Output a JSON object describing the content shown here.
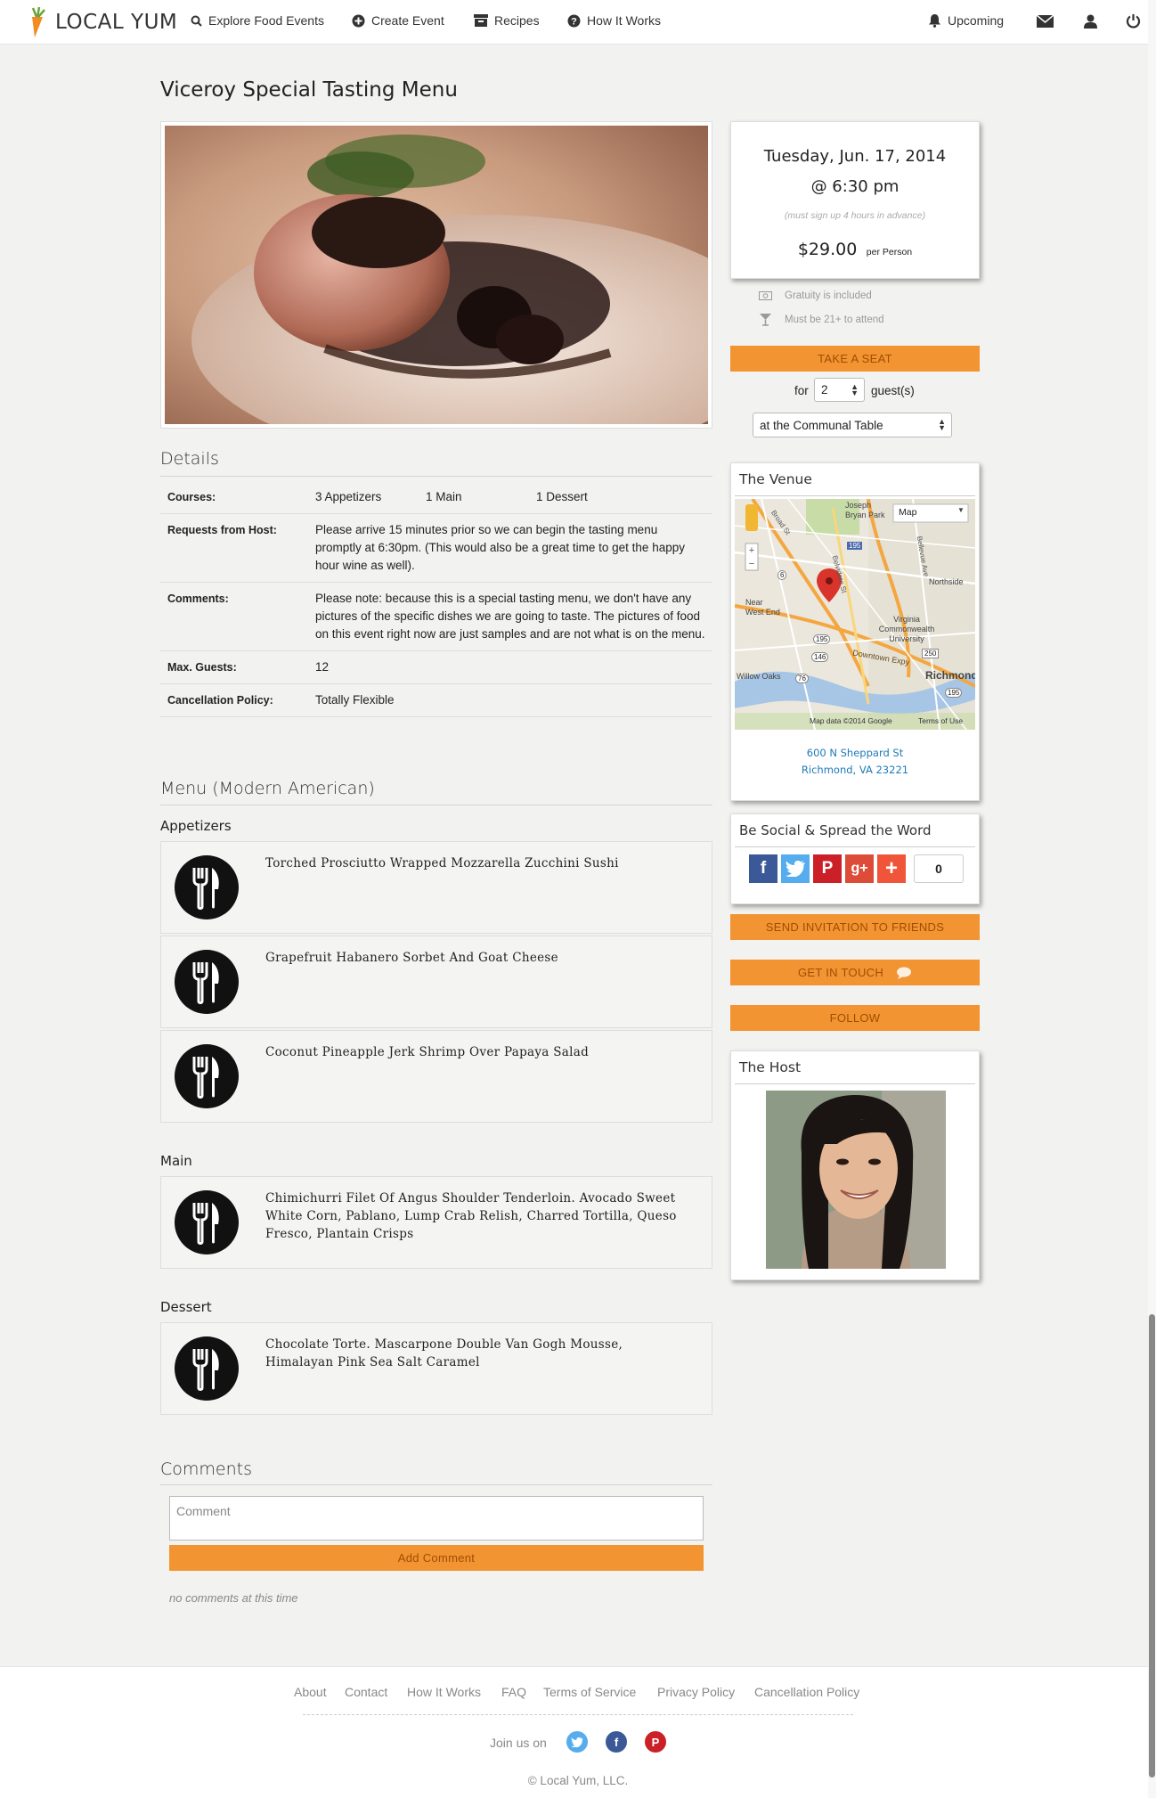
{
  "nav": {
    "logo_text": "LOCAL YUM",
    "explore": "Explore Food Events",
    "create": "Create Event",
    "recipes": "Recipes",
    "how": "How It Works",
    "upcoming": "Upcoming"
  },
  "event": {
    "title": "Viceroy Special Tasting Menu",
    "date": "Tuesday, Jun. 17, 2014",
    "time": "@ 6:30 pm",
    "signup_note": "(must sign up 4 hours in advance)",
    "price": "$29.00",
    "price_unit": "per Person",
    "gratuity": "Gratuity is included",
    "age": "Must be 21+ to attend",
    "take_seat": "TAKE A SEAT",
    "for_label": "for",
    "guests_value": "2",
    "guests_label": "guest(s)",
    "table_option": "at the Communal Table"
  },
  "details": {
    "heading": "Details",
    "courses_label": "Courses:",
    "courses": [
      "3 Appetizers",
      "1 Main",
      "1 Dessert"
    ],
    "requests_label": "Requests from Host:",
    "requests": "Please arrive 15 minutes prior so we can begin the tasting menu promptly at 6:30pm. (This would also be a great time to get the happy hour wine as well).",
    "comments_label": "Comments:",
    "comments": "Please note: because this is a special tasting menu, we don't have any pictures of the specific dishes we are going to taste. The pictures of food on this event right now are just samples and are not what is on the menu.",
    "max_label": "Max. Guests:",
    "max": "12",
    "cancel_label": "Cancellation Policy:",
    "cancel": "Totally Flexible"
  },
  "menu": {
    "heading": "Menu (Modern American)",
    "appetizers_label": "Appetizers",
    "appetizers": [
      "Torched Prosciutto Wrapped Mozzarella Zucchini Sushi",
      "Grapefruit Habanero Sorbet And Goat Cheese",
      "Coconut Pineapple Jerk Shrimp Over Papaya Salad"
    ],
    "main_label": "Main",
    "main": [
      "Chimichurri Filet Of Angus Shoulder Tenderloin. Avocado Sweet White Corn, Pablano, Lump Crab Relish, Charred Tortilla, Queso Fresco, Plantain Crisps"
    ],
    "dessert_label": "Dessert",
    "dessert": [
      "Chocolate Torte. Mascarpone Double Van Gogh Mousse, Himalayan Pink Sea Salt Caramel"
    ]
  },
  "comments": {
    "heading": "Comments",
    "placeholder": "Comment",
    "add_button": "Add Comment",
    "empty": "no comments at this time"
  },
  "venue": {
    "title": "The Venue",
    "map_type": "Map",
    "map_credit": "Map data ©2014 Google",
    "terms": "Terms of Use",
    "map_labels": [
      "Joseph Bryan Park",
      "Northside",
      "Near West End",
      "Virginia Commonwealth University",
      "Willow Oaks",
      "Richmond",
      "Downtown Expy",
      "Broad St",
      "Bellevue Ave",
      "Belvidere St"
    ],
    "routes": [
      "195",
      "6",
      "195",
      "146",
      "76",
      "250",
      "195"
    ],
    "address_line1": "600 N Sheppard St",
    "address_line2": "Richmond, VA 23221"
  },
  "social": {
    "title": "Be Social & Spread the Word",
    "count": "0"
  },
  "actions": {
    "invite": "SEND INVITATION TO FRIENDS",
    "contact": "GET IN TOUCH",
    "follow": "FOLLOW"
  },
  "host": {
    "title": "The Host"
  },
  "footer": {
    "links": [
      "About",
      "Contact",
      "How It Works",
      "FAQ",
      "Terms of Service",
      "Privacy Policy",
      "Cancellation Policy"
    ],
    "join": "Join us on",
    "copyright": "© Local Yum, LLC."
  },
  "colors": {
    "accent": "#f29431",
    "link": "#1f7ab8",
    "facebook": "#3b5998",
    "twitter": "#55acee",
    "pinterest": "#cb2027",
    "gplus": "#dd4b39"
  },
  "icons": [
    "carrot-logo-icon",
    "search-icon",
    "plus-circle-icon",
    "archive-icon",
    "question-icon",
    "bell-icon",
    "envelope-icon",
    "user-icon",
    "power-icon",
    "fork-knife-icon",
    "money-icon",
    "cocktail-icon",
    "map-pin-icon",
    "chat-bubble-icon"
  ]
}
